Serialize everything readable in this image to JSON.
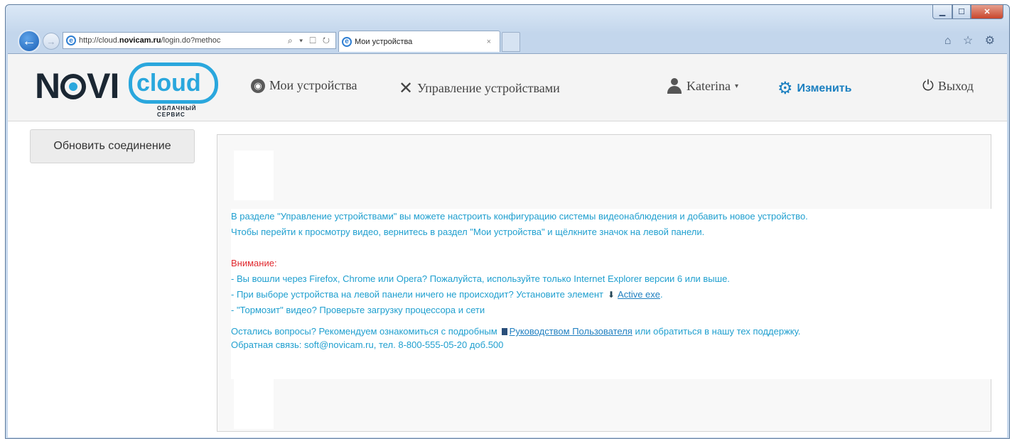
{
  "browser": {
    "url_prefix": "http://cloud.",
    "url_domain": "novicam.ru",
    "url_rest": "/login.do?methoc",
    "addr_tools": "⌕ ▾ ☐ ↻",
    "tab_title": "Мои устройства",
    "tab_close": "×",
    "ie_tools": "⌂ ☆ ⚙"
  },
  "logo": {
    "main": "NOVI",
    "cloud": "cloud",
    "subtitle": "ОБЛАЧНЫЙ СЕРВИС"
  },
  "nav": {
    "my_devices": "Мои устройства",
    "manage_devices": "Управление устройствами",
    "user": "Katerina",
    "edit": "Изменить",
    "logout": "Выход"
  },
  "sidebar": {
    "refresh_button": "Обновить соединение"
  },
  "message": {
    "line1": "В разделе \"Управление устройствами\" вы можете настроить конфигурацию системы видеонаблюдения и добавить новое устройство.",
    "line2": "Чтобы перейти к просмотру видео, вернитесь в раздел \"Мои устройства\" и щёлкните значок на левой панели.",
    "warning_title": "Внимание:",
    "tip1": "- Вы вошли через Firefox, Chrome или Opera? Пожалуйста, используйте только Internet Explorer версии 6 или выше.",
    "tip2_prefix": "- При выборе устройства на левой панели ничего не происходит? Установите элемент",
    "tip2_link": "Active exe",
    "tip3": "- \"Тормозит\" видео? Проверьте загрузку процессора и сети",
    "questions_prefix": "Остались вопросы? Рекомендуем ознакомиться с подробным",
    "questions_link": "Руководством Пользователя",
    "questions_suffix": "или обратиться в нашу тех поддержку.",
    "contact": "Обратная связь: soft@novicam.ru, тел. 8-800-555-05-20 доб.500"
  },
  "colors": {
    "accent": "#1f9fcf",
    "warning": "#e0282e",
    "edit": "#1a7fc0"
  }
}
